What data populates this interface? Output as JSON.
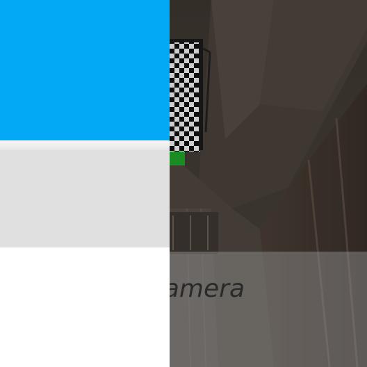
{
  "app": {
    "accent_color": "#03a9f4",
    "divider_color": "#e0e0e0"
  },
  "camera": {
    "caption": "amera",
    "scene_icon": "checkerboard-target-icon"
  }
}
